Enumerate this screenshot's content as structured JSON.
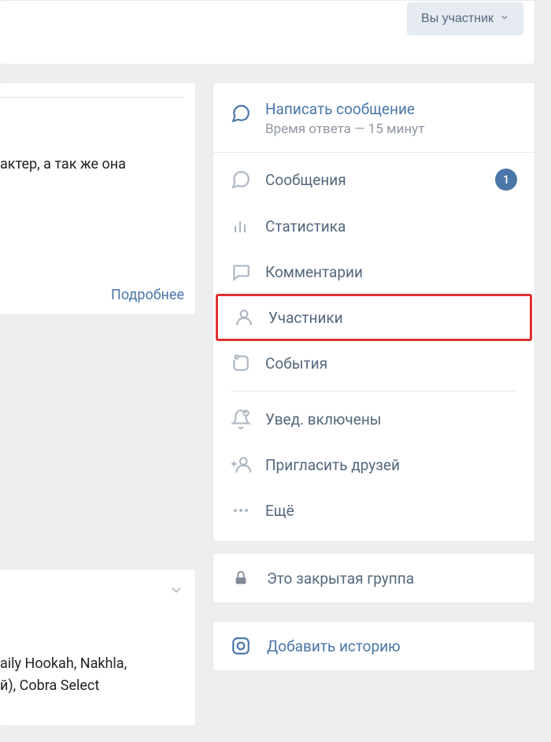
{
  "header": {
    "member_button": "Вы участник"
  },
  "left_top": {
    "text": "актер, а так же она",
    "more": "Подробнее"
  },
  "left_bottom": {
    "line1": "aily Hookah, Nakhla,",
    "line2": "й), Cobra Select"
  },
  "sidebar": {
    "write_message": {
      "title": "Написать сообщение",
      "subtitle": "Время ответа — 15 минут"
    },
    "items": {
      "messages": {
        "label": "Сообщения",
        "badge": "1"
      },
      "stats": {
        "label": "Статистика"
      },
      "comments": {
        "label": "Комментарии"
      },
      "members": {
        "label": "Участники"
      },
      "events": {
        "label": "События"
      },
      "notifications": {
        "label": "Увед. включены"
      },
      "invite": {
        "label": "Пригласить друзей"
      },
      "more": {
        "label": "Ещё"
      }
    }
  },
  "closed_group": {
    "label": "Это закрытая группа"
  },
  "story": {
    "label": "Добавить историю"
  }
}
